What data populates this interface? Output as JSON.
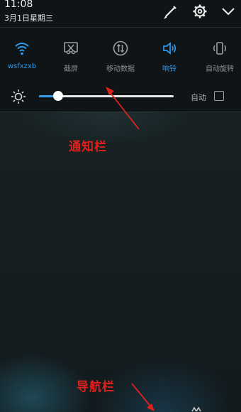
{
  "status": {
    "time": "11:08",
    "date": "3月1日星期三"
  },
  "top_actions": {
    "edit_icon": "pencil-icon",
    "settings_icon": "gear-icon",
    "collapse_icon": "chevron-down-icon"
  },
  "quick_tiles": [
    {
      "label": "wsfxzxb",
      "icon": "wifi-icon",
      "active": true
    },
    {
      "label": "截屏",
      "icon": "screenshot-icon",
      "active": false
    },
    {
      "label": "移动数据",
      "icon": "mobile-data-icon",
      "active": false
    },
    {
      "label": "响铃",
      "icon": "volume-icon",
      "active": true
    },
    {
      "label": "自动旋转",
      "icon": "auto-rotate-icon",
      "active": false
    }
  ],
  "brightness": {
    "level": 0.14,
    "auto_label": "自动",
    "auto_checked": false
  },
  "annotations": {
    "notification_bar": "通知栏",
    "navigation_bar": "导航栏"
  },
  "colors": {
    "accent": "#2e9bf0",
    "annotation": "#e0201c"
  }
}
